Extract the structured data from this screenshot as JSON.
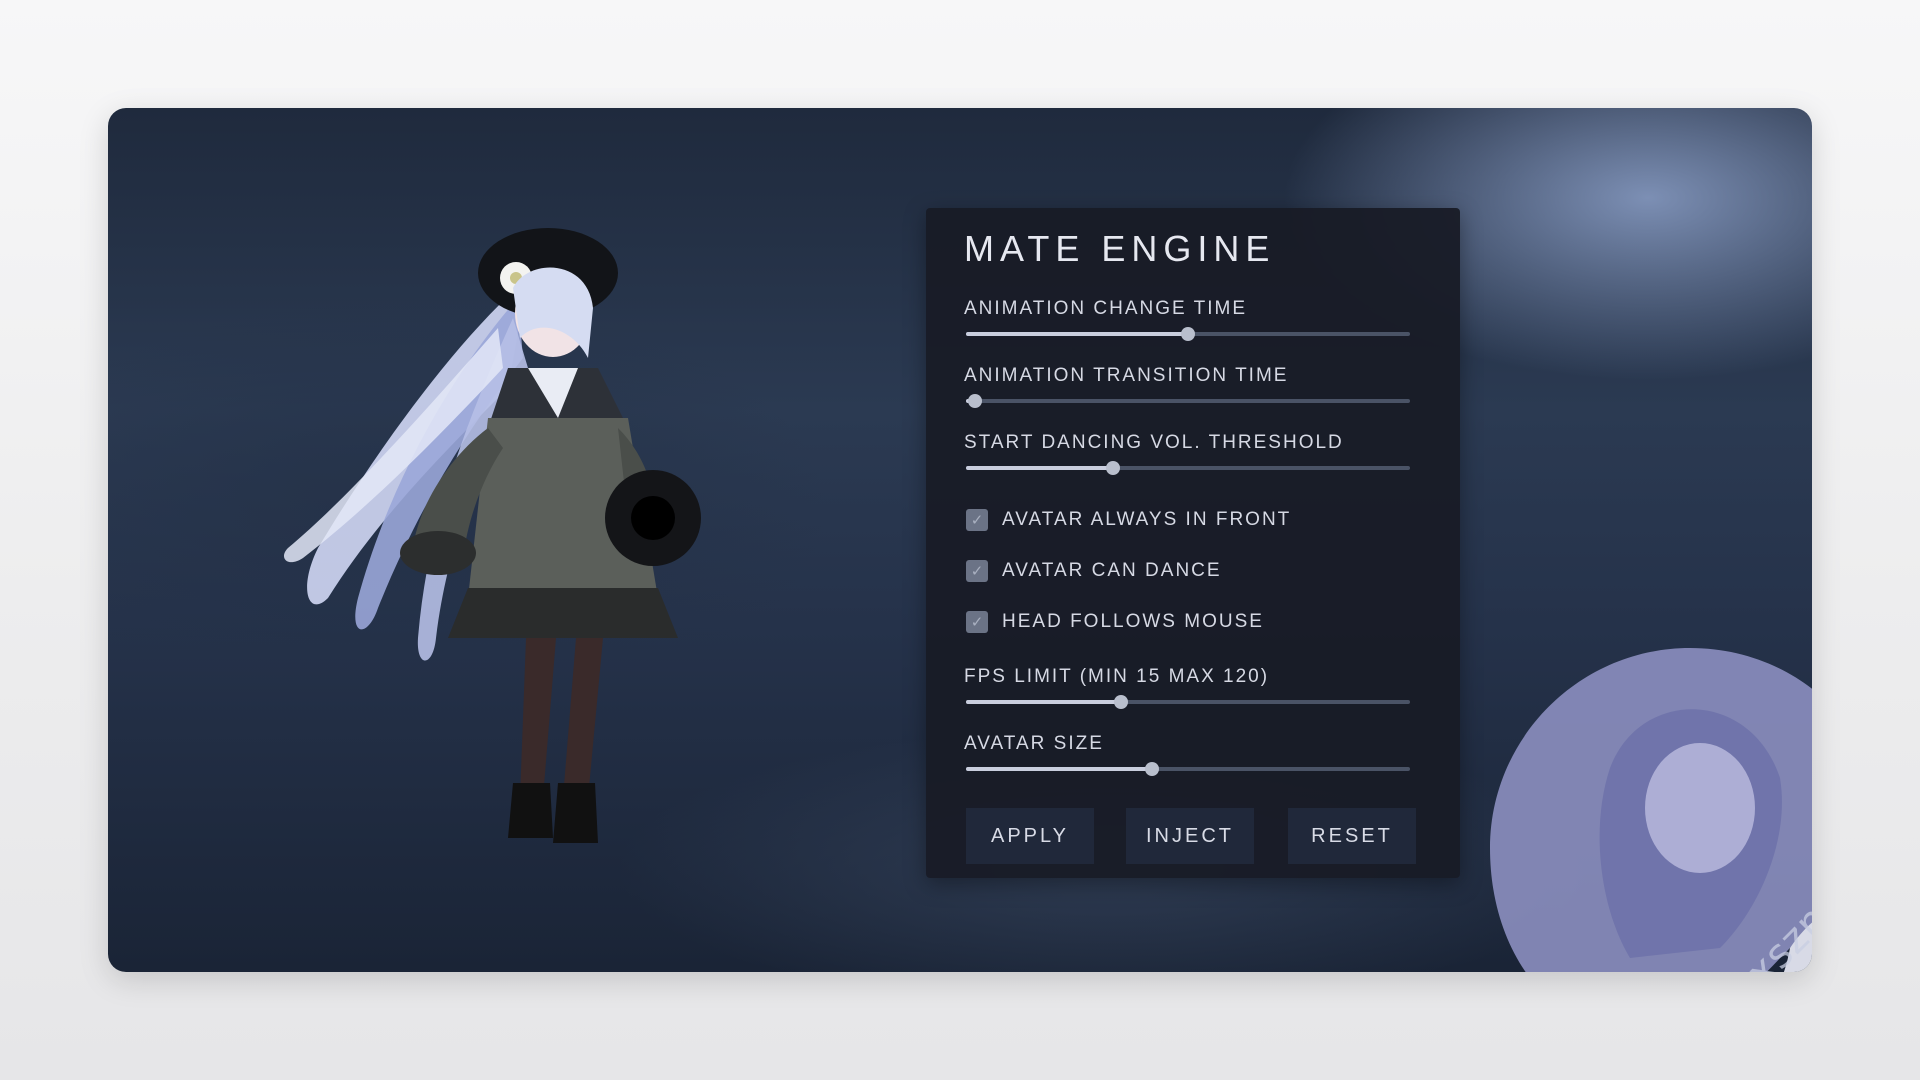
{
  "app": {
    "title": "MATE ENGINE"
  },
  "sliders": [
    {
      "label": "ANIMATION CHANGE TIME",
      "value": 0.5
    },
    {
      "label": "ANIMATION TRANSITION TIME",
      "value": 0.02
    },
    {
      "label": "START DANCING VOL. THRESHOLD",
      "value": 0.33
    },
    {
      "label": "FPS LIMIT (MIN 15 MAX 120)",
      "value": 0.35
    },
    {
      "label": "AVATAR SIZE",
      "value": 0.42
    }
  ],
  "checkboxes": [
    {
      "label": "AVATAR ALWAYS IN FRONT",
      "checked": true
    },
    {
      "label": "AVATAR CAN DANCE",
      "checked": true
    },
    {
      "label": "HEAD FOLLOWS MOUSE",
      "checked": true
    }
  ],
  "buttons": {
    "apply": "APPLY",
    "inject": "INJECT",
    "reset": "RESET"
  },
  "watermark": "xszn.org",
  "icons": {
    "checkbox_check": "check-icon",
    "avatar": "anime-avatar-figure",
    "sticker": "anime-sticker-icon"
  },
  "colors": {
    "panel_bg": "#181b26",
    "slider_fill": "#c9cede",
    "slider_track": "#4a5366",
    "button_bg": "#20283a"
  }
}
